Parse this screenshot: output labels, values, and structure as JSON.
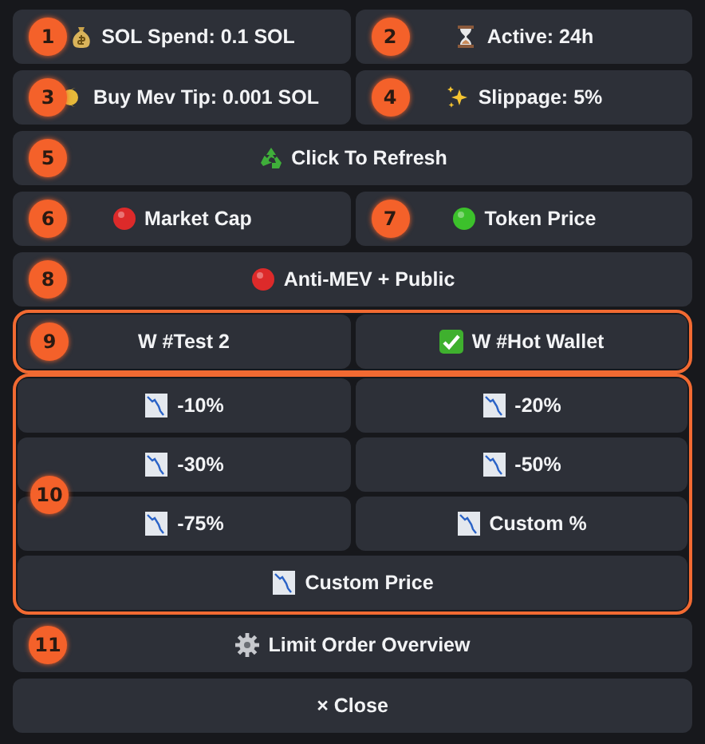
{
  "panel": [
    {
      "kind": "row",
      "buttons": [
        {
          "kind": "money-bag",
          "label": "SOL Spend: 0.1 SOL",
          "marker": "1"
        },
        {
          "kind": "hourglass",
          "label": "Active: 24h",
          "marker": "2"
        }
      ]
    },
    {
      "kind": "row",
      "buttons": [
        {
          "kind": "tip",
          "label": "Buy Mev Tip: 0.001 SOL",
          "marker": "3"
        },
        {
          "kind": "sparkles",
          "label": "Slippage: 5%",
          "marker": "4"
        }
      ]
    },
    {
      "kind": "row",
      "buttons": [
        {
          "kind": "recycle",
          "label": "Click To Refresh",
          "marker": "5"
        }
      ]
    },
    {
      "kind": "row",
      "buttons": [
        {
          "kind": "status",
          "on": false,
          "label": "Market Cap",
          "marker": "6"
        },
        {
          "kind": "status",
          "on": true,
          "label": "Token Price",
          "marker": "7"
        }
      ]
    },
    {
      "kind": "row",
      "buttons": [
        {
          "kind": "status",
          "on": false,
          "label": "Anti-MEV + Public",
          "marker": "8"
        }
      ]
    },
    {
      "kind": "group",
      "marker": "9",
      "rows": [
        {
          "buttons": [
            {
              "kind": "wallet",
              "selected": false,
              "label": "W #Test 2"
            },
            {
              "kind": "wallet",
              "selected": true,
              "label": "W #Hot Wallet"
            }
          ]
        }
      ]
    },
    {
      "kind": "group",
      "marker": "10",
      "rows": [
        {
          "buttons": [
            {
              "kind": "chart-down",
              "label": "-10%"
            },
            {
              "kind": "chart-down",
              "label": "-20%"
            }
          ]
        },
        {
          "buttons": [
            {
              "kind": "chart-down",
              "label": "-30%"
            },
            {
              "kind": "chart-down",
              "label": "-50%"
            }
          ]
        },
        {
          "buttons": [
            {
              "kind": "chart-down",
              "label": "-75%"
            },
            {
              "kind": "chart-down",
              "label": "Custom %"
            }
          ]
        },
        {
          "buttons": [
            {
              "kind": "chart-down",
              "label": "Custom Price"
            }
          ]
        }
      ]
    },
    {
      "kind": "row",
      "buttons": [
        {
          "kind": "gear",
          "label": "Limit Order Overview",
          "marker": "11"
        }
      ]
    },
    {
      "kind": "row",
      "buttons": [
        {
          "kind": "plain",
          "label": "× Close"
        }
      ]
    }
  ]
}
